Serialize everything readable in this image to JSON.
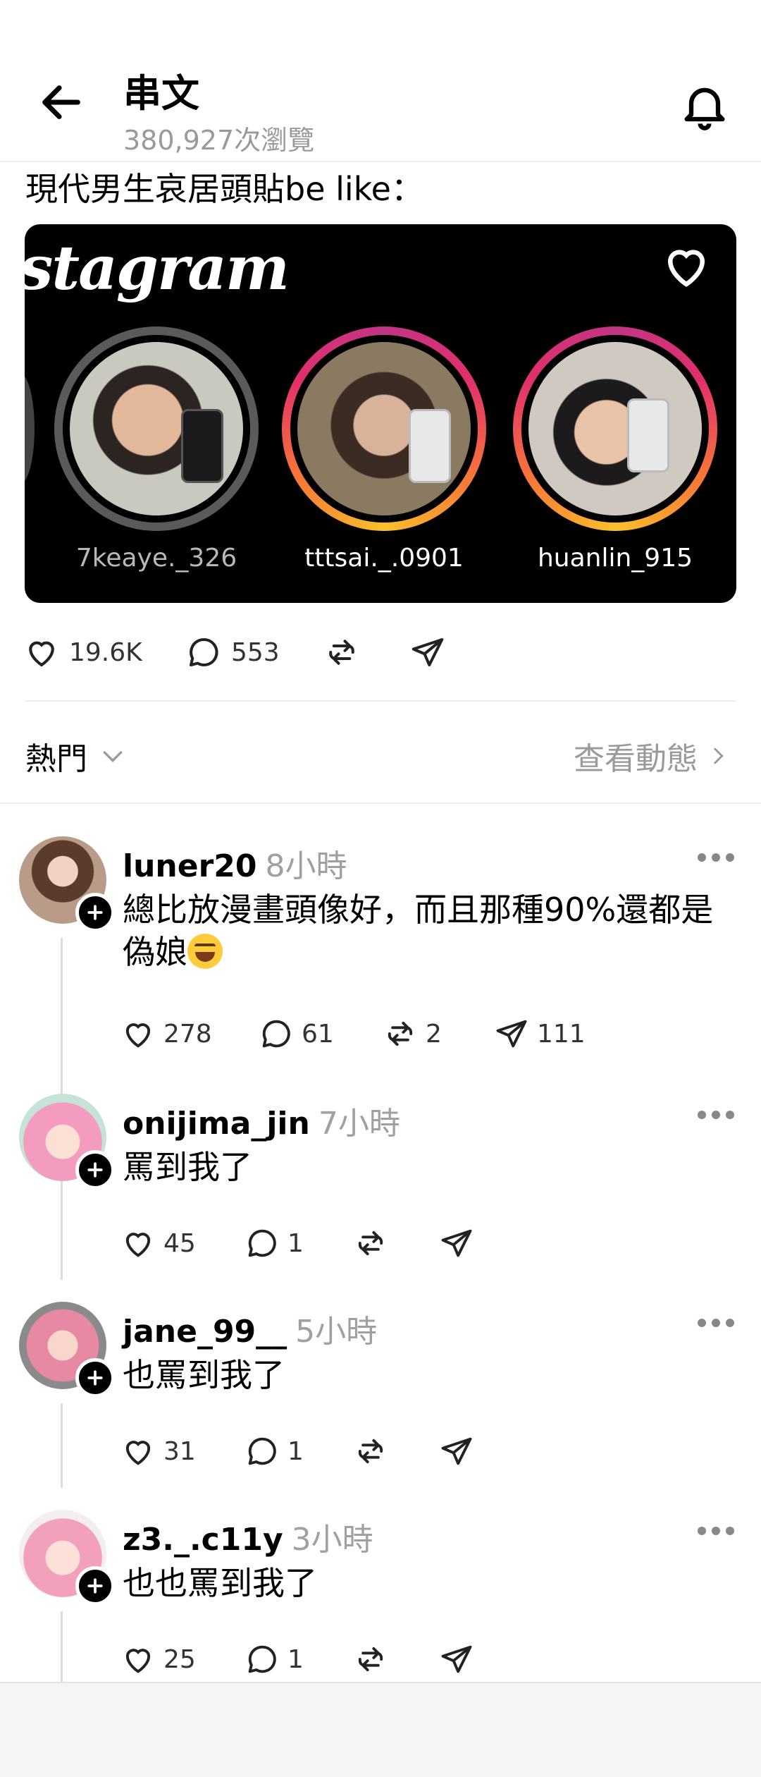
{
  "header": {
    "title": "串文",
    "views": "380,927次瀏覽"
  },
  "post": {
    "text": "現代男生哀居頭貼be like：",
    "image": {
      "logo_text": "stagram",
      "stories": [
        {
          "name": "7keaye._326",
          "ring": "seen"
        },
        {
          "name": "tttsai._.0901",
          "ring": "new"
        },
        {
          "name": "huanlin_915",
          "ring": "new"
        }
      ]
    },
    "actions": {
      "likes": "19.6K",
      "comments": "553"
    }
  },
  "sort": {
    "label": "熱門",
    "activity_link": "查看動態"
  },
  "comments": [
    {
      "username": "luner20",
      "time": "8小時",
      "text": "總比放漫畫頭像好，而且那種90%還都是偽娘",
      "emoji": "grinning-squinting-face",
      "likes": "278",
      "replies": "61",
      "reposts": "2",
      "shares": "111"
    },
    {
      "username": "onijima_jin",
      "time": "7小時",
      "text": "罵到我了",
      "likes": "45",
      "replies": "1"
    },
    {
      "username": "jane_99__",
      "time": "5小時",
      "text": "也罵到我了",
      "likes": "31",
      "replies": "1"
    },
    {
      "username": "z3._.c11y",
      "time": "3小時",
      "text": "也也罵到我了",
      "likes": "25",
      "replies": "1"
    }
  ],
  "colors": {
    "secondary_text": "#9a9a9a",
    "divider": "#ececec",
    "story_ring_gradient": [
      "#f9c02b",
      "#f77737",
      "#e1306c",
      "#c13584"
    ]
  }
}
